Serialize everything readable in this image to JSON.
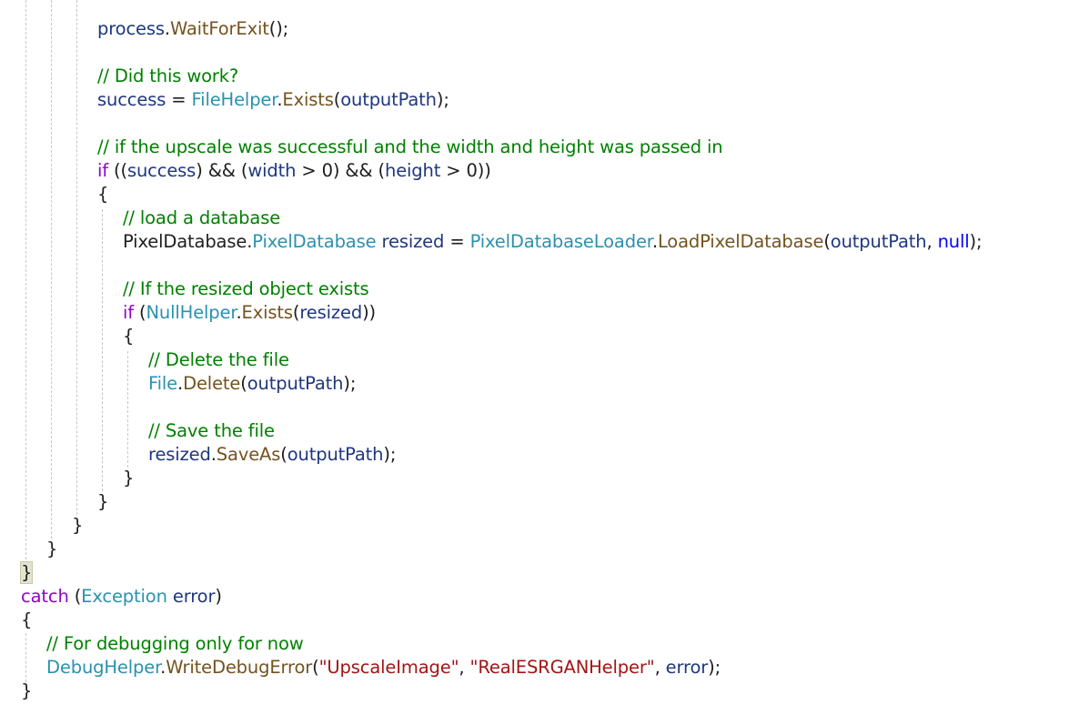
{
  "colors": {
    "background": "#ffffff",
    "plain": "#1e1e1e",
    "control_keyword": "#8f08c4",
    "keyword": "#0000ff",
    "type": "#2b91af",
    "method": "#74531f",
    "variable": "#1f377f",
    "comment": "#008000",
    "string": "#a31515",
    "indent_guide": "#c8c8c8",
    "brace_highlight": "#e3e3d0"
  },
  "code": {
    "l1": {
      "t1": "process",
      "t2": ".",
      "t3": "WaitForExit",
      "t4": "();"
    },
    "l2": {
      "t1": "// Did this work?"
    },
    "l3": {
      "t1": "success",
      "t2": " = ",
      "t3": "FileHelper",
      "t4": ".",
      "t5": "Exists",
      "t6": "(",
      "t7": "outputPath",
      "t8": ");"
    },
    "l4": {
      "t1": "// if the upscale was successful and the width and height was passed in"
    },
    "l5": {
      "t1": "if",
      "t2": " ((",
      "t3": "success",
      "t4": ") && (",
      "t5": "width",
      "t6": " > 0) && (",
      "t7": "height",
      "t8": " > 0))"
    },
    "l6": {
      "t1": "{"
    },
    "l7": {
      "t1": "// load a database"
    },
    "l8": {
      "t1": "PixelDatabase",
      "t2": ".",
      "t3": "PixelDatabase",
      "t4": " ",
      "t5": "resized",
      "t6": " = ",
      "t7": "PixelDatabaseLoader",
      "t8": ".",
      "t9": "LoadPixelDatabase",
      "t10": "(",
      "t11": "outputPath",
      "t12": ", ",
      "t13": "null",
      "t14": ");"
    },
    "l9": {
      "t1": "// If the resized object exists"
    },
    "l10": {
      "t1": "if",
      "t2": " (",
      "t3": "NullHelper",
      "t4": ".",
      "t5": "Exists",
      "t6": "(",
      "t7": "resized",
      "t8": "))"
    },
    "l11": {
      "t1": "{"
    },
    "l12": {
      "t1": "// Delete the file"
    },
    "l13": {
      "t1": "File",
      "t2": ".",
      "t3": "Delete",
      "t4": "(",
      "t5": "outputPath",
      "t6": ");"
    },
    "l14": {
      "t1": "// Save the file"
    },
    "l15": {
      "t1": "resized",
      "t2": ".",
      "t3": "SaveAs",
      "t4": "(",
      "t5": "outputPath",
      "t6": ");"
    },
    "l16": {
      "t1": "}"
    },
    "l17": {
      "t1": "}"
    },
    "l18": {
      "t1": "}"
    },
    "l19": {
      "t1": "}"
    },
    "l20": {
      "t1": "}"
    },
    "l21": {
      "t1": "catch",
      "t2": " (",
      "t3": "Exception",
      "t4": " ",
      "t5": "error",
      "t6": ")"
    },
    "l22": {
      "t1": "{"
    },
    "l23": {
      "t1": "// For debugging only for now"
    },
    "l24": {
      "t1": "DebugHelper",
      "t2": ".",
      "t3": "WriteDebugError",
      "t4": "(",
      "t5": "\"UpscaleImage\"",
      "t6": ", ",
      "t7": "\"RealESRGANHelper\"",
      "t8": ", ",
      "t9": "error",
      "t10": ");"
    },
    "l25": {
      "t1": "}"
    }
  }
}
